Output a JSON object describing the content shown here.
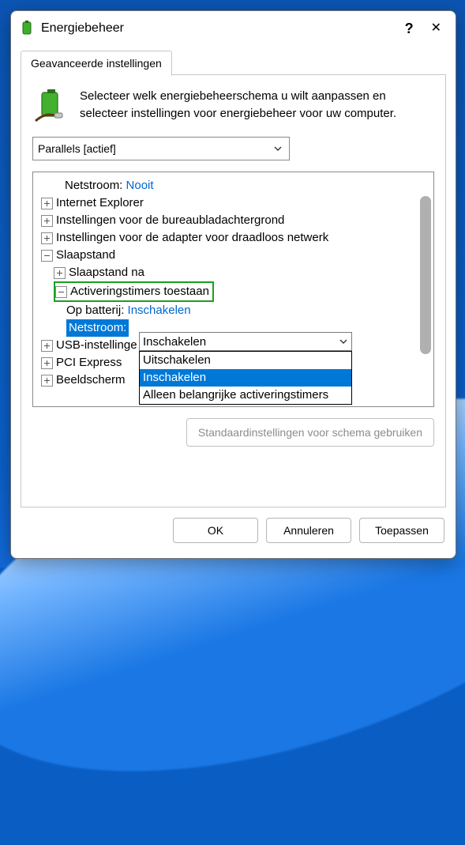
{
  "window": {
    "title": "Energiebeheer",
    "tab": "Geavanceerde instellingen",
    "intro": "Selecteer welk energiebeheerschema u wilt aanpassen en selecteer instellingen voor energiebeheer voor uw computer.",
    "scheme": "Parallels [actief]"
  },
  "tree": {
    "netstroom_label": "Netstroom:",
    "netstroom_value": "Nooit",
    "items": {
      "ie": "Internet Explorer",
      "desktopbg": "Instellingen voor de bureaubladachtergrond",
      "wifi": "Instellingen voor de adapter voor draadloos netwerk",
      "sleep": "Slaapstand",
      "sleep_after": "Slaapstand na",
      "wake_timers": "Activeringstimers toestaan",
      "on_battery_label": "Op batterij:",
      "on_battery_value": "Inschakelen",
      "on_ac_label": "Netstroom:",
      "usb": "USB-instellinge",
      "pci": "PCI Express",
      "display": "Beeldscherm"
    }
  },
  "combo": {
    "selected": "Inschakelen",
    "options": {
      "off": "Uitschakelen",
      "on": "Inschakelen",
      "important": "Alleen belangrijke activeringstimers"
    }
  },
  "buttons": {
    "defaults": "Standaardinstellingen voor schema gebruiken",
    "ok": "OK",
    "cancel": "Annuleren",
    "apply": "Toepassen"
  }
}
